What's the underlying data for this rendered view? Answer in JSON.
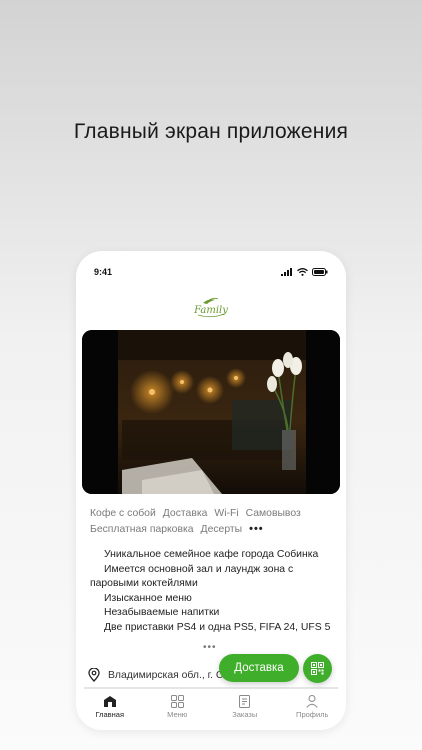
{
  "headline": "Главный экран приложения",
  "status_bar": {
    "time": "9:41"
  },
  "logo": {
    "text": "Family"
  },
  "tags": [
    "Кофе с собой",
    "Доставка",
    "Wi-Fi",
    "Самовывоз",
    "Бесплатная парковка",
    "Десерты"
  ],
  "tags_more": "•••",
  "description": [
    "Уникальное семейное кафе города Собинка",
    "Имеется основной зал и лаундж зона с паровыми коктейлями",
    "Изысканное меню",
    "Незабываемые напитки",
    "Две приставки PS4 и одна PS5, FIFA 24,   UFS 5"
  ],
  "expand_dots": "•••",
  "address": "Владимирская обл., г. Собинка,",
  "actions": {
    "delivery_label": "Доставка"
  },
  "tabs": [
    {
      "label": "Главная",
      "icon": "home-icon",
      "active": true
    },
    {
      "label": "Меню",
      "icon": "grid-icon",
      "active": false
    },
    {
      "label": "Заказы",
      "icon": "receipt-icon",
      "active": false
    },
    {
      "label": "Профиль",
      "icon": "person-icon",
      "active": false
    }
  ],
  "colors": {
    "accent": "#3fae2a",
    "logo": "#6a9a2f"
  }
}
